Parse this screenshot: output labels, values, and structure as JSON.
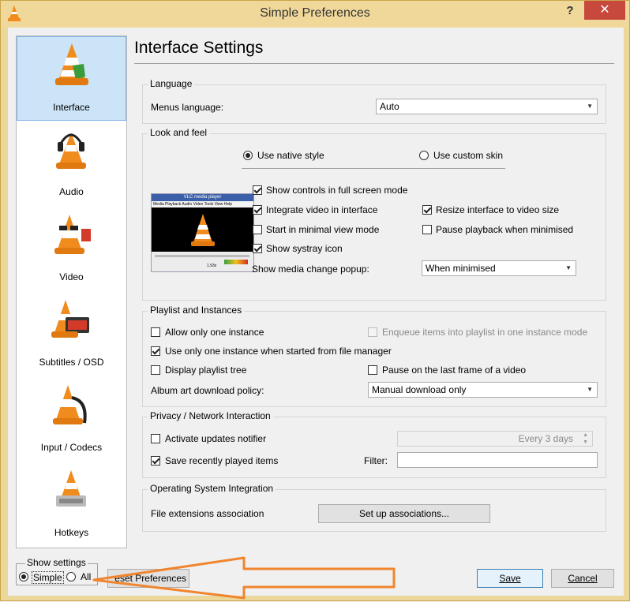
{
  "window": {
    "title": "Simple Preferences",
    "help_glyph": "?",
    "close_glyph": "✕"
  },
  "sidebar": {
    "items": [
      {
        "label": "Interface",
        "icon": "vlc-cone-interface-icon",
        "selected": true
      },
      {
        "label": "Audio",
        "icon": "vlc-cone-headphones-icon",
        "selected": false
      },
      {
        "label": "Video",
        "icon": "vlc-cone-glasses-icon",
        "selected": false
      },
      {
        "label": "Subtitles / OSD",
        "icon": "vlc-cone-clock-icon",
        "selected": false
      },
      {
        "label": "Input / Codecs",
        "icon": "vlc-cone-cable-icon",
        "selected": false
      },
      {
        "label": "Hotkeys",
        "icon": "vlc-cone-keyboard-icon",
        "selected": false
      }
    ]
  },
  "page": {
    "title": "Interface Settings"
  },
  "language": {
    "group_label": "Language",
    "menus_language_label": "Menus language:",
    "menus_language_value": "Auto"
  },
  "look": {
    "group_label": "Look and feel",
    "native_style": "Use native style",
    "custom_skin": "Use custom skin",
    "preview_title": "VLC media player",
    "preview_menu": "Media  Playback  Audio  Video  Tools  View  Help",
    "preview_time": "1.93x",
    "show_controls": "Show controls in full screen mode",
    "integrate_video": "Integrate video in interface",
    "resize_interface": "Resize interface to video size",
    "minimal_view": "Start in minimal view mode",
    "pause_minimised": "Pause playback when minimised",
    "systray": "Show systray icon",
    "media_popup_label": "Show media change popup:",
    "media_popup_value": "When minimised"
  },
  "playlist": {
    "group_label": "Playlist and Instances",
    "one_instance": "Allow only one instance",
    "enqueue": "Enqueue items into playlist in one instance mode",
    "file_manager": "Use only one instance when started from file manager",
    "playlist_tree": "Display playlist tree",
    "pause_last_frame": "Pause on the last frame of a video",
    "album_art_label": "Album art download policy:",
    "album_art_value": "Manual download only"
  },
  "privacy": {
    "group_label": "Privacy / Network Interaction",
    "updates": "Activate updates notifier",
    "updates_interval": "Every 3 days",
    "recent": "Save recently played items",
    "filter_label": "Filter:",
    "filter_value": ""
  },
  "os": {
    "group_label": "Operating System Integration",
    "file_ext_label": "File extensions association",
    "setup_button": "Set up associations..."
  },
  "footer": {
    "show_settings_label": "Show settings",
    "simple": "Simple",
    "all": "All",
    "reset_fragment": "eset Preferences",
    "save": "Save",
    "cancel": "Cancel"
  },
  "colors": {
    "title_bar": "#f0d89a",
    "close_button": "#c7483c",
    "selection": "#cce4f7",
    "annotation_arrow": "#f0852d"
  }
}
